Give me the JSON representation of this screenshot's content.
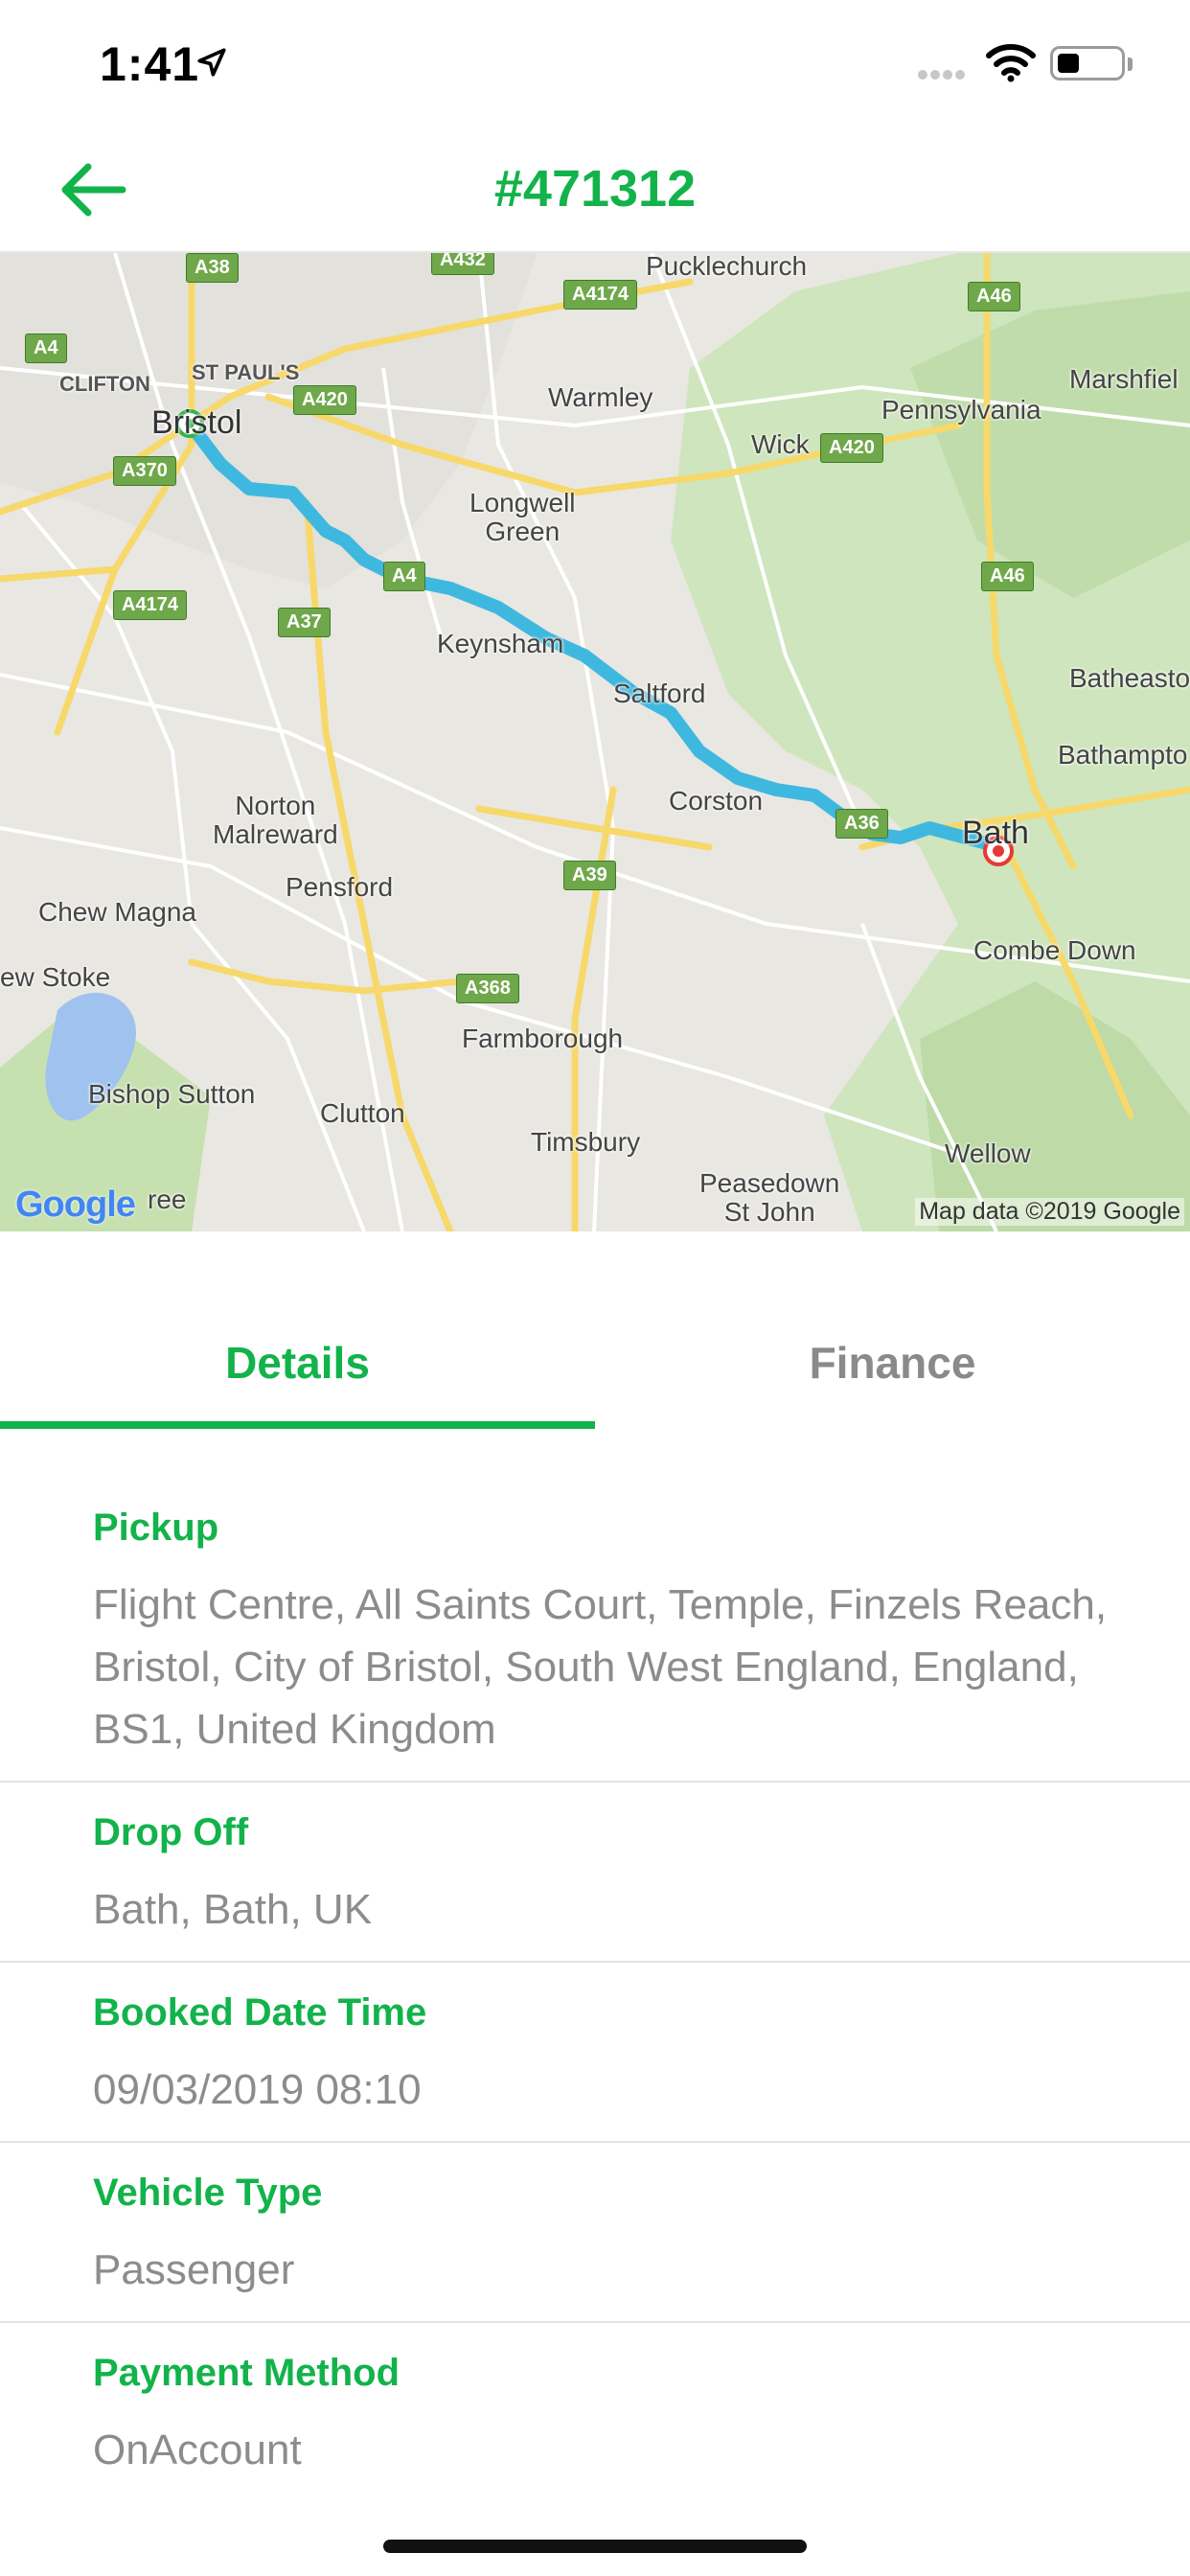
{
  "status_bar": {
    "time": "1:41",
    "battery_level": 0.35,
    "icons": [
      "location-arrow-icon",
      "signal-icon",
      "wifi-icon",
      "battery-icon"
    ]
  },
  "nav": {
    "title": "#471312",
    "back_icon": "arrow-left-icon",
    "accent_color": "#12b34a"
  },
  "map": {
    "places": {
      "bristol": "Bristol",
      "clifton": "CLIFTON",
      "st_pauls": "ST PAUL'S",
      "warmley": "Warmley",
      "pennsylvania": "Pennsylvania",
      "marshfield": "Marshfiel",
      "wick": "Wick",
      "longwell_green": "Longwell\nGreen",
      "keynsham": "Keynsham",
      "saltford": "Saltford",
      "batheaston": "Batheasto",
      "bathampton": "Bathampto",
      "corston": "Corston",
      "bath": "Bath",
      "norton_malreward": "Norton\nMalreward",
      "pensford": "Pensford",
      "chew_magna": "Chew Magna",
      "new_stoke": "ew Stoke",
      "combe_down": "Combe Down",
      "farmborough": "Farmborough",
      "bishop_sutton": "Bishop Sutton",
      "clutton": "Clutton",
      "timsbury": "Timsbury",
      "wellow": "Wellow",
      "peasedown": "Peasedown\nSt John",
      "west_harptree": "ree",
      "pucklechurch": "Pucklechurch"
    },
    "roads": {
      "a38": "A38",
      "a432": "A432",
      "a4174_top": "A4174",
      "a46_top": "A46",
      "a4": "A4",
      "a420_left": "A420",
      "a420_right": "A420",
      "a370": "A370",
      "a46_mid": "A46",
      "a4174_left": "A4174",
      "a37": "A37",
      "a4_mid": "A4",
      "a39": "A39",
      "a36": "A36",
      "a368": "A368"
    },
    "google_logo": "Google",
    "credit": "Map data ©2019 Google",
    "route_color": "#3fb8e0"
  },
  "tabs": {
    "details": "Details",
    "finance": "Finance",
    "active": "Details"
  },
  "details": {
    "pickup": {
      "label": "Pickup",
      "value": "Flight Centre, All Saints Court, Temple, Finzels Reach, Bristol, City of Bristol, South West England, England, BS1, United Kingdom"
    },
    "dropoff": {
      "label": "Drop Off",
      "value": "Bath, Bath, UK"
    },
    "booked": {
      "label": "Booked Date Time",
      "value": "09/03/2019 08:10"
    },
    "vehicle": {
      "label": "Vehicle Type",
      "value": "Passenger"
    },
    "payment": {
      "label": "Payment Method",
      "value": "OnAccount"
    }
  }
}
